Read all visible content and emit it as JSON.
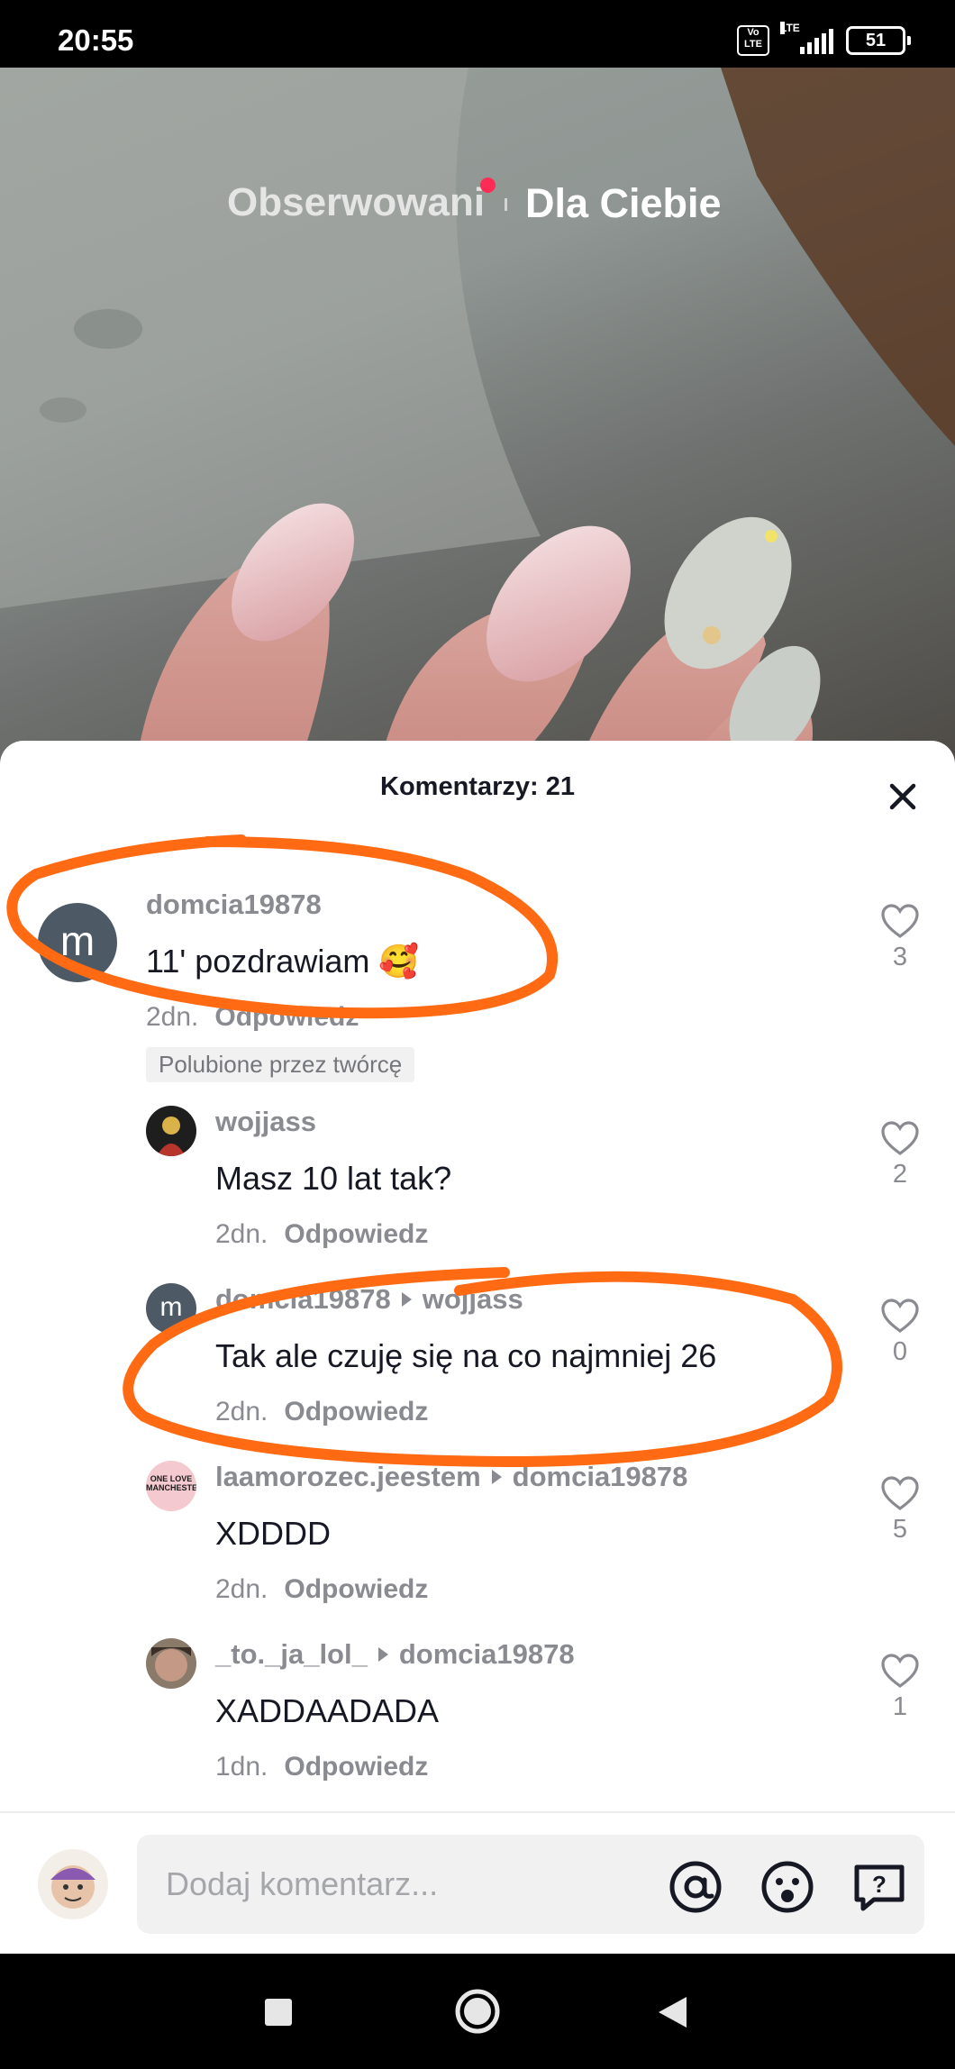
{
  "status_bar": {
    "time": "20:55",
    "volte": "Vo LTE",
    "network": "LTE",
    "battery": "51"
  },
  "feed_tabs": {
    "following": "Obserwowani",
    "for_you": "Dla Ciebie"
  },
  "comments": {
    "title": "Komentarzy: 21",
    "items": [
      {
        "avatar_letter": "m",
        "username": "domcia19878",
        "text": "11' pozdrawiam 🥰",
        "time": "2dn.",
        "reply_label": "Odpowiedz",
        "likes": "3",
        "badge": "Polubione przez twórcę"
      },
      {
        "username": "wojjass",
        "text": "Masz 10 lat tak?",
        "time": "2dn.",
        "reply_label": "Odpowiedz",
        "likes": "2"
      },
      {
        "avatar_letter": "m",
        "username": "domcia19878",
        "reply_to": "wojjass",
        "text": "Tak ale czuję się na co najmniej 26",
        "time": "2dn.",
        "reply_label": "Odpowiedz",
        "likes": "0"
      },
      {
        "avatar_text": "ONE LOVE MANCHESTER",
        "username": "laamorozec.jeestem",
        "reply_to": "domcia19878",
        "text": "XDDDD",
        "time": "2dn.",
        "reply_label": "Odpowiedz",
        "likes": "5"
      },
      {
        "username": "_to._ja_lol_",
        "reply_to": "domcia19878",
        "text": "XADDAADADA",
        "time": "1dn.",
        "reply_label": "Odpowiedz",
        "likes": "1"
      }
    ]
  },
  "input": {
    "placeholder": "Dodaj komentarz..."
  },
  "colors": {
    "accent": "#fe2c55",
    "annotation": "#ff6a13",
    "text_primary": "#161823",
    "text_secondary": "#8a8b91"
  }
}
